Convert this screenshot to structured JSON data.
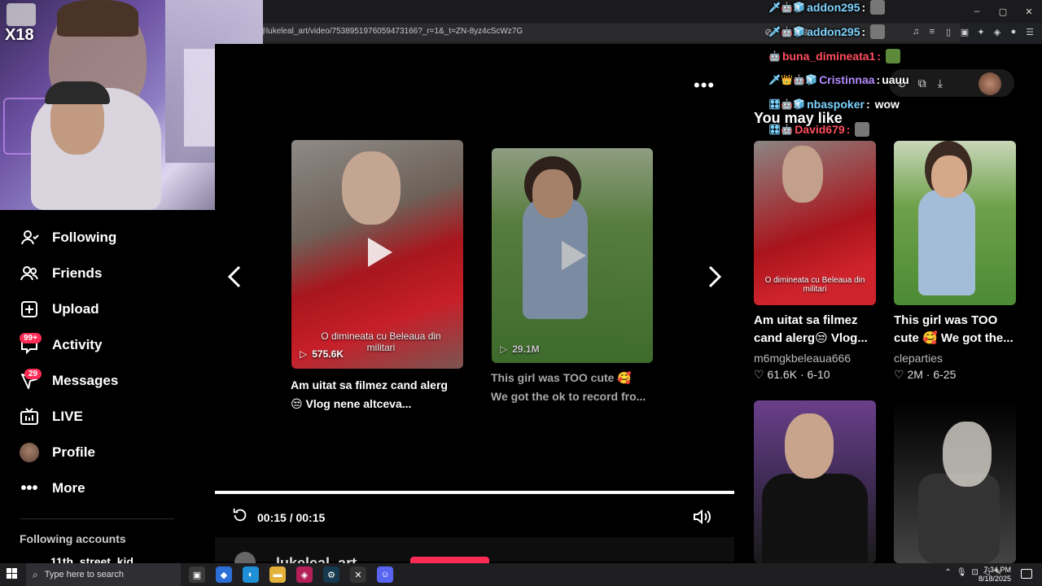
{
  "browser": {
    "url": "/@lukeleal_art/video/7538951976059473166?_r=1&_t=ZN-8yz4cScWz7G",
    "window_controls": [
      "–",
      "▢",
      "✕"
    ]
  },
  "stream": {
    "channel_badge": "X18"
  },
  "nav": {
    "items": [
      {
        "label": "Following",
        "icon": "following-icon"
      },
      {
        "label": "Friends",
        "icon": "friends-icon"
      },
      {
        "label": "Upload",
        "icon": "upload-icon"
      },
      {
        "label": "Activity",
        "icon": "activity-icon",
        "badge": "99+"
      },
      {
        "label": "Messages",
        "icon": "messages-icon",
        "badge": "29"
      },
      {
        "label": "LIVE",
        "icon": "live-icon"
      },
      {
        "label": "Profile",
        "icon": "profile-avatar"
      },
      {
        "label": "More",
        "icon": "more-icon"
      }
    ],
    "following_accounts_title": "Following accounts",
    "first_following_account": "11th_street_kid"
  },
  "player": {
    "cards": [
      {
        "title": "Am uitat sa filmez cand alerg",
        "title_line2": "😒 Vlog nene altceva...",
        "overlay_caption": "O dimineata cu Beleaua din militari",
        "views": "575.6K"
      },
      {
        "title": "This girl was TOO cute 🥰",
        "title_line2": "We got the ok to record fro...",
        "views": "29.1M"
      }
    ],
    "time": "00:15 / 00:15",
    "author_name": "lukeleal_art",
    "progress": 1.0
  },
  "right": {
    "section_title": "You may like",
    "videos": [
      {
        "title_line1": "Am uitat sa filmez",
        "title_line2": "cand alerg😒 Vlog...",
        "author": "m6mgkbeleaua666",
        "likes": "61.6K",
        "date": "6-10",
        "overlay_caption": "O dimineata cu Beleaua din militari"
      },
      {
        "title_line1": "This girl was TOO",
        "title_line2": "cute 🥰 We got the...",
        "author": "cleparties",
        "likes": "2M",
        "date": "6-25"
      }
    ]
  },
  "chat": [
    {
      "user": "addon295",
      "color": "#7fd4ff",
      "message": "",
      "badges": "🗡🤖🧊"
    },
    {
      "user": "addon295",
      "color": "#7fd4ff",
      "message": "",
      "badges": "🗡🤖🧊"
    },
    {
      "user": "buna_dimineata1",
      "color": "#ff4d5e",
      "message": "",
      "badges": "🤖"
    },
    {
      "user": "Cristinnaa",
      "color": "#b58cff",
      "message": "uauu",
      "badges": "🗡👑🤖🧊"
    },
    {
      "user": "nbaspoker",
      "color": "#7fd4ff",
      "message": "wow",
      "badges": "🎛🤖🧊"
    },
    {
      "user": "David679",
      "color": "#ff4d5e",
      "message": "",
      "badges": "🎛🤖"
    }
  ],
  "taskbar": {
    "search_placeholder": "Type here to search",
    "time": "7:34 PM",
    "date": "8/18/2025"
  }
}
